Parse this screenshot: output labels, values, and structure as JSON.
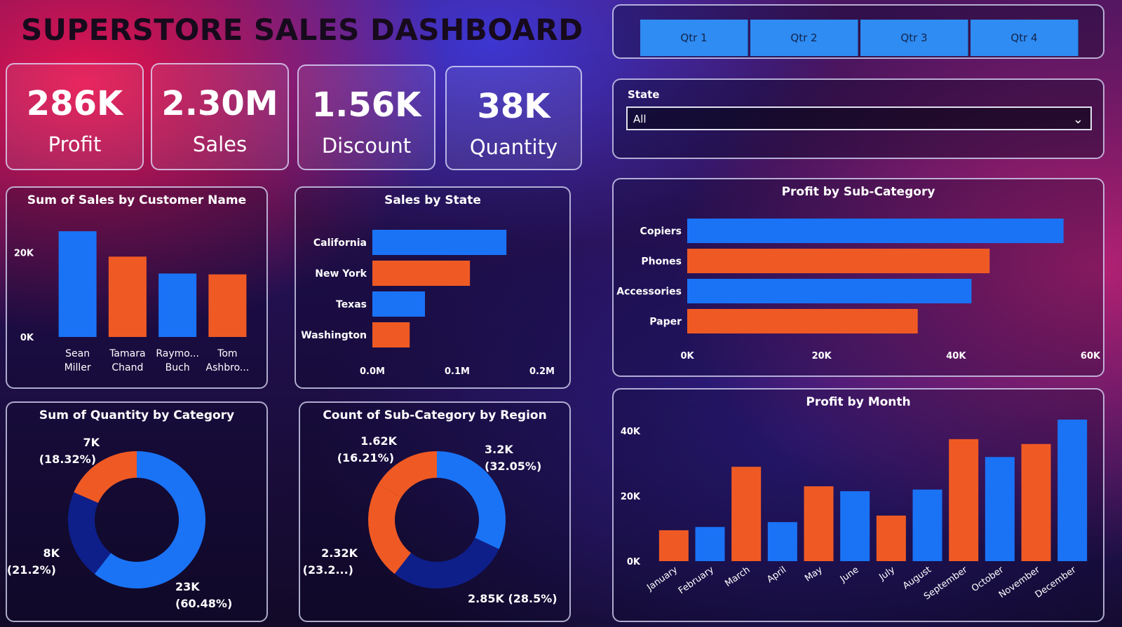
{
  "title": "SUPERSTORE SALES DASHBOARD",
  "kpis": [
    {
      "value": "286K",
      "label": "Profit"
    },
    {
      "value": "2.30M",
      "label": "Sales"
    },
    {
      "value": "1.56K",
      "label": "Discount"
    },
    {
      "value": "38K",
      "label": "Quantity"
    }
  ],
  "quarters": [
    "Qtr 1",
    "Qtr 2",
    "Qtr 3",
    "Qtr 4"
  ],
  "state_filter": {
    "label": "State",
    "value": "All"
  },
  "colors": {
    "blue": "#1a73f5",
    "orange": "#ef5a24",
    "navy": "#0e1f8a",
    "grid_text": "#ffffff"
  },
  "chart_data": [
    {
      "type": "bar",
      "title": "Sum of Sales by Customer Name",
      "categories": [
        [
          "Sean",
          "Miller"
        ],
        [
          "Tamara",
          "Chand"
        ],
        [
          "Raymo...",
          "Buch"
        ],
        [
          "Tom",
          "Ashbro..."
        ]
      ],
      "values": [
        25000,
        19000,
        15000,
        14800
      ],
      "yticks": [
        {
          "v": 0,
          "label": "0K"
        },
        {
          "v": 20000,
          "label": "20K"
        }
      ],
      "ylim": [
        0,
        27000
      ],
      "bar_colors": [
        "blue",
        "orange",
        "blue",
        "orange"
      ]
    },
    {
      "type": "bar",
      "orientation": "horizontal",
      "title": "Sales by State",
      "categories": [
        "California",
        "New York",
        "Texas",
        "Washington"
      ],
      "values": [
        158000,
        115000,
        62000,
        44000
      ],
      "xticks": [
        {
          "v": 0,
          "label": "0.0M"
        },
        {
          "v": 100000,
          "label": "0.1M"
        },
        {
          "v": 200000,
          "label": "0.2M"
        }
      ],
      "xlim": [
        0,
        200000
      ],
      "bar_colors": [
        "blue",
        "orange",
        "blue",
        "orange"
      ]
    },
    {
      "type": "bar",
      "orientation": "horizontal",
      "title": "Profit by Sub-Category",
      "categories": [
        "Copiers",
        "Phones",
        "Accessories",
        "Paper"
      ],
      "values": [
        56000,
        45000,
        42300,
        34300
      ],
      "xticks": [
        {
          "v": 0,
          "label": "0K"
        },
        {
          "v": 20000,
          "label": "20K"
        },
        {
          "v": 40000,
          "label": "40K"
        },
        {
          "v": 60000,
          "label": "60K"
        }
      ],
      "xlim": [
        0,
        60000
      ],
      "bar_colors": [
        "blue",
        "orange",
        "blue",
        "orange"
      ]
    },
    {
      "type": "pie",
      "title": "Sum of Quantity by Category",
      "slices": [
        {
          "value": 23000,
          "label": "23K",
          "pct": "(60.48%)",
          "color": "blue"
        },
        {
          "value": 8000,
          "label": "8K",
          "pct": "(21.2%)",
          "color": "navy"
        },
        {
          "value": 7000,
          "label": "7K",
          "pct": "(18.32%)",
          "color": "orange"
        }
      ]
    },
    {
      "type": "pie",
      "title": "Count of Sub-Category by Region",
      "slices": [
        {
          "value": 3200,
          "label": "3.2K",
          "pct": "(32.05%)",
          "color": "blue"
        },
        {
          "value": 2850,
          "label": "2.85K (28.5%)",
          "pct": "",
          "color": "navy"
        },
        {
          "value": 2320,
          "label": "2.32K",
          "pct": "(23.2...)",
          "color": "orange"
        },
        {
          "value": 1620,
          "label": "1.62K",
          "pct": "(16.21%)",
          "color": "orange"
        }
      ]
    },
    {
      "type": "bar",
      "title": "Profit by Month",
      "categories": [
        "January",
        "February",
        "March",
        "April",
        "May",
        "June",
        "July",
        "August",
        "September",
        "October",
        "November",
        "December"
      ],
      "values": [
        9500,
        10500,
        29000,
        12000,
        23000,
        21500,
        14000,
        22000,
        37500,
        32000,
        36000,
        43500
      ],
      "yticks": [
        {
          "v": 0,
          "label": "0K"
        },
        {
          "v": 20000,
          "label": "20K"
        },
        {
          "v": 40000,
          "label": "40K"
        }
      ],
      "ylim": [
        0,
        45000
      ],
      "bar_colors": [
        "orange",
        "blue",
        "orange",
        "blue",
        "orange",
        "blue",
        "orange",
        "blue",
        "orange",
        "blue",
        "orange",
        "blue"
      ]
    }
  ]
}
